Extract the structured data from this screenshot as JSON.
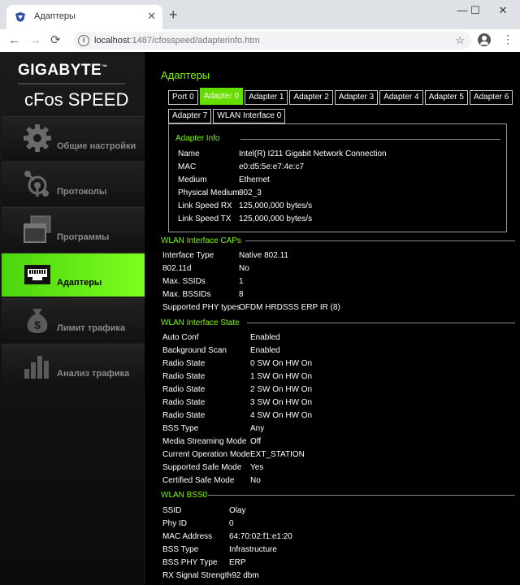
{
  "browser": {
    "tab_title": "Адаптеры",
    "new_tab": "+",
    "tab_close": "✕",
    "url_host": "localhost",
    "url_path": ":1487/cfosspeed/adapterinfo.htm",
    "window_minimize": "—",
    "window_maximize": "☐",
    "window_close": "✕",
    "back": "←",
    "forward": "→",
    "reload": "⟳",
    "star": "☆",
    "menu": "⋮",
    "info": "i"
  },
  "sidebar": {
    "brand": "GIGABYTE",
    "brand_tm": "™",
    "product": "cFos SPEED",
    "items": [
      {
        "label": "Общие настройки",
        "icon": "gear-icon"
      },
      {
        "label": "Протоколы",
        "icon": "network-icon"
      },
      {
        "label": "Программы",
        "icon": "windows-icon"
      },
      {
        "label": "Адаптеры",
        "icon": "ethernet-port-icon"
      },
      {
        "label": "Лимит трафика",
        "icon": "money-bag-icon"
      },
      {
        "label": "Анализ трафика",
        "icon": "bar-chart-icon"
      }
    ],
    "active_index": 3,
    "accent": "#66dd00"
  },
  "main": {
    "title": "Адаптеры",
    "tabs_row1": [
      "Port 0",
      "Adapter 0",
      "Adapter 1",
      "Adapter 2",
      "Adapter 3",
      "Adapter 4",
      "Adapter 5",
      "Adapter 6"
    ],
    "tabs_row2": [
      "Adapter 7",
      "WLAN Interface 0"
    ],
    "selected_tab": "Adapter 0",
    "adapter_info": {
      "legend": "Adapter Info",
      "rows": [
        {
          "k": "Name",
          "v": "Intel(R) I211 Gigabit Network Connection"
        },
        {
          "k": "MAC",
          "v": "e0:d5:5e:e7:4e:c7"
        },
        {
          "k": "Medium",
          "v": "Ethernet"
        },
        {
          "k": "Physical Medium",
          "v": "802_3"
        },
        {
          "k": "Link Speed RX",
          "v": "125,000,000 bytes/s"
        },
        {
          "k": "Link Speed TX",
          "v": "125,000,000 bytes/s"
        }
      ]
    },
    "wlan_caps": {
      "title": "WLAN Interface CAPs",
      "rows": [
        {
          "k": "Interface Type",
          "v": "Native 802.11"
        },
        {
          "k": "802.11d",
          "v": "No"
        },
        {
          "k": "Max. SSIDs",
          "v": "1"
        },
        {
          "k": "Max. BSSIDs",
          "v": "8"
        },
        {
          "k": "Supported PHY types",
          "v": "OFDM HRDSSS ERP IR (8)"
        }
      ]
    },
    "wlan_state": {
      "title": "WLAN Interface State",
      "rows": [
        {
          "k": "Auto Conf",
          "v": "Enabled"
        },
        {
          "k": "Background Scan",
          "v": "Enabled"
        },
        {
          "k": "Radio State",
          "v": "0 SW On HW On"
        },
        {
          "k": "Radio State",
          "v": "1 SW On HW On"
        },
        {
          "k": "Radio State",
          "v": "2 SW On HW On"
        },
        {
          "k": "Radio State",
          "v": "3 SW On HW On"
        },
        {
          "k": "Radio State",
          "v": "4 SW On HW On"
        },
        {
          "k": "BSS Type",
          "v": "Any"
        },
        {
          "k": "Media Streaming Mode",
          "v": "Off"
        },
        {
          "k": "Current Operation Mode",
          "v": "EXT_STATION"
        },
        {
          "k": "Supported Safe Mode",
          "v": "Yes"
        },
        {
          "k": "Certified Safe Mode",
          "v": "No"
        }
      ]
    },
    "wlan_bss": {
      "title": "WLAN BSS0",
      "rows": [
        {
          "k": "SSID",
          "v": "Olay"
        },
        {
          "k": "Phy ID",
          "v": "0"
        },
        {
          "k": "MAC Address",
          "v": "64:70:02:f1:e1:20"
        },
        {
          "k": "BSS Type",
          "v": "Infrastructure"
        },
        {
          "k": "BSS PHY Type",
          "v": "ERP"
        },
        {
          "k": "RX Signal Strength",
          "v": "-92 dbm"
        }
      ]
    }
  }
}
